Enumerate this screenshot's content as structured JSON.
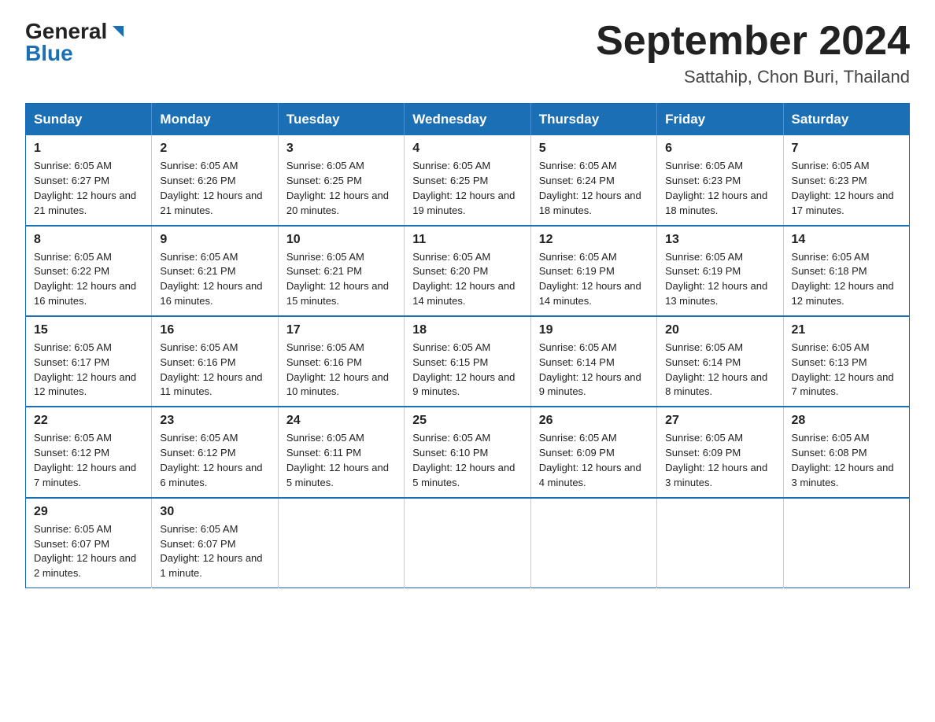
{
  "logo": {
    "general": "General",
    "blue": "Blue"
  },
  "title": "September 2024",
  "subtitle": "Sattahip, Chon Buri, Thailand",
  "headers": [
    "Sunday",
    "Monday",
    "Tuesday",
    "Wednesday",
    "Thursday",
    "Friday",
    "Saturday"
  ],
  "weeks": [
    [
      {
        "day": "1",
        "sunrise": "Sunrise: 6:05 AM",
        "sunset": "Sunset: 6:27 PM",
        "daylight": "Daylight: 12 hours and 21 minutes."
      },
      {
        "day": "2",
        "sunrise": "Sunrise: 6:05 AM",
        "sunset": "Sunset: 6:26 PM",
        "daylight": "Daylight: 12 hours and 21 minutes."
      },
      {
        "day": "3",
        "sunrise": "Sunrise: 6:05 AM",
        "sunset": "Sunset: 6:25 PM",
        "daylight": "Daylight: 12 hours and 20 minutes."
      },
      {
        "day": "4",
        "sunrise": "Sunrise: 6:05 AM",
        "sunset": "Sunset: 6:25 PM",
        "daylight": "Daylight: 12 hours and 19 minutes."
      },
      {
        "day": "5",
        "sunrise": "Sunrise: 6:05 AM",
        "sunset": "Sunset: 6:24 PM",
        "daylight": "Daylight: 12 hours and 18 minutes."
      },
      {
        "day": "6",
        "sunrise": "Sunrise: 6:05 AM",
        "sunset": "Sunset: 6:23 PM",
        "daylight": "Daylight: 12 hours and 18 minutes."
      },
      {
        "day": "7",
        "sunrise": "Sunrise: 6:05 AM",
        "sunset": "Sunset: 6:23 PM",
        "daylight": "Daylight: 12 hours and 17 minutes."
      }
    ],
    [
      {
        "day": "8",
        "sunrise": "Sunrise: 6:05 AM",
        "sunset": "Sunset: 6:22 PM",
        "daylight": "Daylight: 12 hours and 16 minutes."
      },
      {
        "day": "9",
        "sunrise": "Sunrise: 6:05 AM",
        "sunset": "Sunset: 6:21 PM",
        "daylight": "Daylight: 12 hours and 16 minutes."
      },
      {
        "day": "10",
        "sunrise": "Sunrise: 6:05 AM",
        "sunset": "Sunset: 6:21 PM",
        "daylight": "Daylight: 12 hours and 15 minutes."
      },
      {
        "day": "11",
        "sunrise": "Sunrise: 6:05 AM",
        "sunset": "Sunset: 6:20 PM",
        "daylight": "Daylight: 12 hours and 14 minutes."
      },
      {
        "day": "12",
        "sunrise": "Sunrise: 6:05 AM",
        "sunset": "Sunset: 6:19 PM",
        "daylight": "Daylight: 12 hours and 14 minutes."
      },
      {
        "day": "13",
        "sunrise": "Sunrise: 6:05 AM",
        "sunset": "Sunset: 6:19 PM",
        "daylight": "Daylight: 12 hours and 13 minutes."
      },
      {
        "day": "14",
        "sunrise": "Sunrise: 6:05 AM",
        "sunset": "Sunset: 6:18 PM",
        "daylight": "Daylight: 12 hours and 12 minutes."
      }
    ],
    [
      {
        "day": "15",
        "sunrise": "Sunrise: 6:05 AM",
        "sunset": "Sunset: 6:17 PM",
        "daylight": "Daylight: 12 hours and 12 minutes."
      },
      {
        "day": "16",
        "sunrise": "Sunrise: 6:05 AM",
        "sunset": "Sunset: 6:16 PM",
        "daylight": "Daylight: 12 hours and 11 minutes."
      },
      {
        "day": "17",
        "sunrise": "Sunrise: 6:05 AM",
        "sunset": "Sunset: 6:16 PM",
        "daylight": "Daylight: 12 hours and 10 minutes."
      },
      {
        "day": "18",
        "sunrise": "Sunrise: 6:05 AM",
        "sunset": "Sunset: 6:15 PM",
        "daylight": "Daylight: 12 hours and 9 minutes."
      },
      {
        "day": "19",
        "sunrise": "Sunrise: 6:05 AM",
        "sunset": "Sunset: 6:14 PM",
        "daylight": "Daylight: 12 hours and 9 minutes."
      },
      {
        "day": "20",
        "sunrise": "Sunrise: 6:05 AM",
        "sunset": "Sunset: 6:14 PM",
        "daylight": "Daylight: 12 hours and 8 minutes."
      },
      {
        "day": "21",
        "sunrise": "Sunrise: 6:05 AM",
        "sunset": "Sunset: 6:13 PM",
        "daylight": "Daylight: 12 hours and 7 minutes."
      }
    ],
    [
      {
        "day": "22",
        "sunrise": "Sunrise: 6:05 AM",
        "sunset": "Sunset: 6:12 PM",
        "daylight": "Daylight: 12 hours and 7 minutes."
      },
      {
        "day": "23",
        "sunrise": "Sunrise: 6:05 AM",
        "sunset": "Sunset: 6:12 PM",
        "daylight": "Daylight: 12 hours and 6 minutes."
      },
      {
        "day": "24",
        "sunrise": "Sunrise: 6:05 AM",
        "sunset": "Sunset: 6:11 PM",
        "daylight": "Daylight: 12 hours and 5 minutes."
      },
      {
        "day": "25",
        "sunrise": "Sunrise: 6:05 AM",
        "sunset": "Sunset: 6:10 PM",
        "daylight": "Daylight: 12 hours and 5 minutes."
      },
      {
        "day": "26",
        "sunrise": "Sunrise: 6:05 AM",
        "sunset": "Sunset: 6:09 PM",
        "daylight": "Daylight: 12 hours and 4 minutes."
      },
      {
        "day": "27",
        "sunrise": "Sunrise: 6:05 AM",
        "sunset": "Sunset: 6:09 PM",
        "daylight": "Daylight: 12 hours and 3 minutes."
      },
      {
        "day": "28",
        "sunrise": "Sunrise: 6:05 AM",
        "sunset": "Sunset: 6:08 PM",
        "daylight": "Daylight: 12 hours and 3 minutes."
      }
    ],
    [
      {
        "day": "29",
        "sunrise": "Sunrise: 6:05 AM",
        "sunset": "Sunset: 6:07 PM",
        "daylight": "Daylight: 12 hours and 2 minutes."
      },
      {
        "day": "30",
        "sunrise": "Sunrise: 6:05 AM",
        "sunset": "Sunset: 6:07 PM",
        "daylight": "Daylight: 12 hours and 1 minute."
      },
      null,
      null,
      null,
      null,
      null
    ]
  ]
}
